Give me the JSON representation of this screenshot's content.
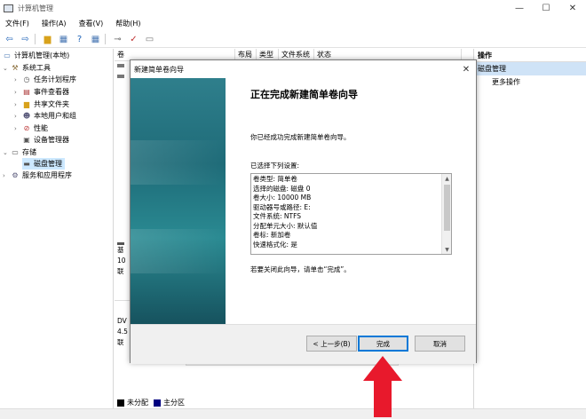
{
  "window": {
    "title": "计算机管理",
    "min": "—",
    "max": "☐",
    "close": "✕"
  },
  "menu": [
    "文件(F)",
    "操作(A)",
    "查看(V)",
    "帮助(H)"
  ],
  "tree": {
    "root": "计算机管理(本地)",
    "system_tools": "系统工具",
    "task_scheduler": "任务计划程序",
    "event_viewer": "事件查看器",
    "shared_folders": "共享文件夹",
    "local_users": "本地用户和组",
    "performance": "性能",
    "device_manager": "设备管理器",
    "storage": "存储",
    "disk_management": "磁盘管理",
    "services": "服务和应用程序"
  },
  "columns": {
    "volume": "卷",
    "layout": "布局",
    "type": "类型",
    "filesystem": "文件系统",
    "status": "状态"
  },
  "disk_fragments": {
    "basic_label": "基",
    "basic_size": "10",
    "basic_state": "联",
    "dvd_label": "DV",
    "dvd_size": "4.5",
    "dvd_state": "联"
  },
  "legend": {
    "unallocated": "未分配",
    "primary": "主分区",
    "unallocated_color": "#000000",
    "primary_color": "#000080"
  },
  "actions": {
    "header": "操作",
    "section": "磁盘管理",
    "more": "更多操作"
  },
  "wizard": {
    "title": "新建简单卷向导",
    "heading": "正在完成新建简单卷向导",
    "description": "你已经成功完成新建简单卷向导。",
    "selected_title": "已选择下列设置:",
    "settings": [
      "卷类型: 简单卷",
      "选择的磁盘: 磁盘 0",
      "卷大小: 10000 MB",
      "驱动器号或路径: E:",
      "文件系统: NTFS",
      "分配单元大小: 默认值",
      "卷标: 新加卷",
      "快速格式化: 是"
    ],
    "close_hint": "若要关闭此向导，请单击“完成”。",
    "back_button": "< 上一步(B)",
    "finish_button": "完成",
    "cancel_button": "取消"
  },
  "colors": {
    "accent": "#0078d7",
    "annotation_arrow": "#e8192c",
    "sidebar_teal": "#1e6b78"
  }
}
